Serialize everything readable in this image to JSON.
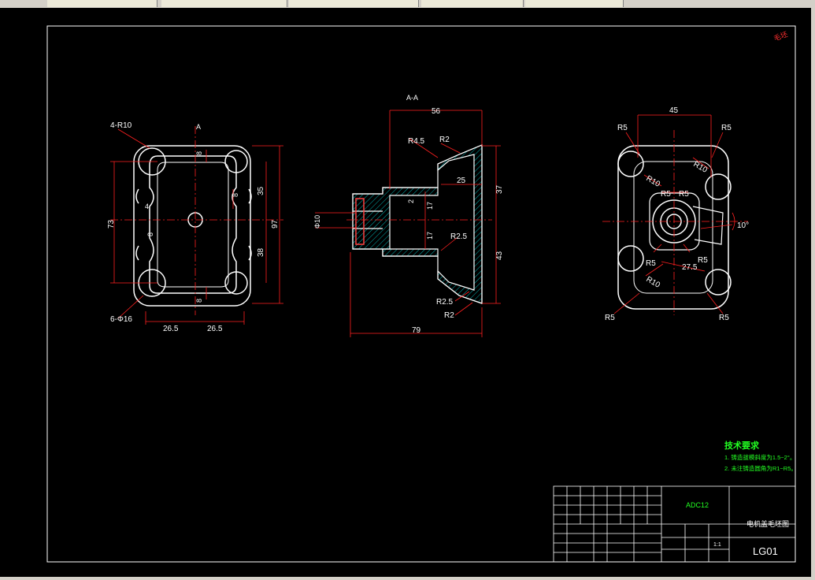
{
  "colors": {
    "background": "#000000",
    "outline": "#ffffff",
    "dimension": "#ff2020",
    "hatch": "#00b0b0",
    "notes": "#22ff22",
    "stamp": "#ff3030"
  },
  "views": {
    "left": {
      "labels": [
        "4-R10",
        "A",
        "8",
        "8",
        "35",
        "73",
        "97",
        "4",
        "8",
        "38",
        "8",
        "6-Φ16",
        "26.5",
        "26.5"
      ]
    },
    "section": {
      "title": "A-A",
      "labels": [
        "56",
        "R4.5",
        "R2",
        "25",
        "37",
        "Φ10",
        "2",
        "17",
        "17",
        "R2.5",
        "43",
        "R2.5",
        "R2",
        "79"
      ]
    },
    "right": {
      "labels": [
        "45",
        "R5",
        "R5",
        "R10",
        "R10",
        "R5",
        "R5",
        "10°",
        "R5",
        "R5",
        "27.5",
        "R10",
        "R5",
        "R5"
      ]
    }
  },
  "notes": {
    "heading": "技术要求",
    "items": [
      "1. 铸造拔模斜度为1.5~2°。",
      "2. 未注铸造圆角为R1~R5。"
    ]
  },
  "title_block": {
    "material": "ADC12",
    "drawing_name": "电机盖毛坯图",
    "drawing_no": "LG01",
    "scale": "1:1"
  },
  "stamp": "毛坯"
}
